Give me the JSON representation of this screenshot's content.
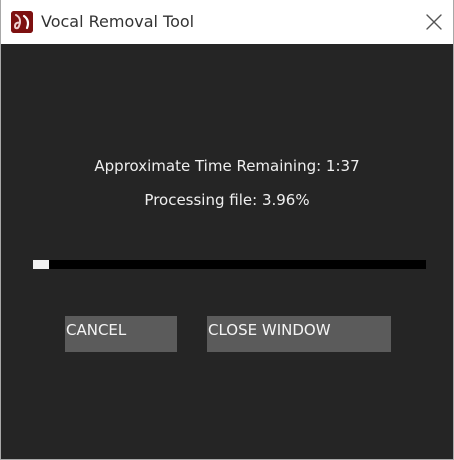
{
  "window": {
    "title": "Vocal Removal Tool",
    "app_icon": "vocal-remover-app-icon",
    "close_icon": "close-icon"
  },
  "status": {
    "time_remaining": "Approximate Time Remaining: 1:37",
    "processing": "Processing file: 3.96%"
  },
  "progress": {
    "percent": 3.96
  },
  "buttons": {
    "cancel_label": "CANCEL",
    "close_window_label": "CLOSE WINDOW"
  },
  "colors": {
    "background": "#252525",
    "button": "#5b5b5b",
    "progress_track": "#000000",
    "progress_fill": "#f2f2f2",
    "app_icon": "#7d1010"
  }
}
